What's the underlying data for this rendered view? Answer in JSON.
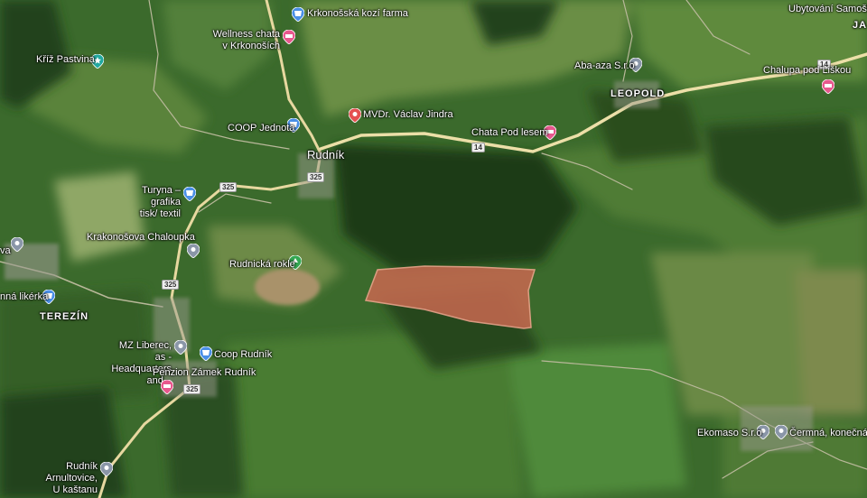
{
  "map": {
    "places": {
      "rudnik": "Rudník",
      "leopold": "LEOPOLD",
      "terezin": "TEREZÍN",
      "ja": "JA"
    },
    "roads": {
      "r325_a": "325",
      "r325_b": "325",
      "r325_c": "325",
      "r325_d": "325",
      "r14_a": "14",
      "r14_b": "14"
    },
    "pois": [
      {
        "id": "krkonosska",
        "label": "Krkonošská kozí farma",
        "icon": "shopping-pin",
        "color": "#4a8fe6"
      },
      {
        "id": "wellness",
        "label": "Wellness chata\nv Krkonoších",
        "icon": "hotel-pin",
        "color": "#e7588d"
      },
      {
        "id": "kriz",
        "label": "Kříž Pastvina",
        "icon": "attraction-pin",
        "color": "#22a9a0"
      },
      {
        "id": "coop_jednota",
        "label": "COOP Jednota",
        "icon": "shopping-pin",
        "color": "#4a8fe6"
      },
      {
        "id": "mvdr",
        "label": "MVDr. Václav Jindra",
        "icon": "place-pin",
        "color": "#e45050"
      },
      {
        "id": "chata_pod_lesem",
        "label": "Chata Pod lesem",
        "icon": "hotel-pin",
        "color": "#e7588d"
      },
      {
        "id": "aba_aza",
        "label": "Aba-aza S.r.o",
        "icon": "place-pin",
        "color": "#8a96a8"
      },
      {
        "id": "chalupa",
        "label": "Chalupa pod Liškou",
        "icon": "hotel-pin",
        "color": "#e7588d"
      },
      {
        "id": "ubytovani",
        "label": "Ubytování Samoška",
        "icon": "",
        "color": ""
      },
      {
        "id": "turyna",
        "label": "Turyna – grafika\ntisk/ textil",
        "icon": "shopping-pin",
        "color": "#4a8fe6"
      },
      {
        "id": "krakonosova",
        "label": "Krakonošova Chaloupka",
        "icon": "place-pin",
        "color": "#8a96a8"
      },
      {
        "id": "rudnicka",
        "label": "Rudnická rokle",
        "icon": "park-pin",
        "color": "#34a853"
      },
      {
        "id": "likerka",
        "label": "nná likérka",
        "icon": "shopping-pin",
        "color": "#4a8fe6"
      },
      {
        "id": "mz_liberec",
        "label": "MZ Liberec, as -\nHeadquarters and...",
        "icon": "place-pin",
        "color": "#8a96a8"
      },
      {
        "id": "coop_rudnik",
        "label": "Coop Rudník",
        "icon": "shopping-pin",
        "color": "#4a8fe6"
      },
      {
        "id": "penzion",
        "label": "Penzion Zámek Rudník",
        "icon": "hotel-pin",
        "color": "#e7588d"
      },
      {
        "id": "arnultovice",
        "label": "Rudník Arnultovice,\nU kaštanu",
        "icon": "place-pin",
        "color": "#8a96a8"
      },
      {
        "id": "ekomaso",
        "label": "Ekomaso S.r.o",
        "icon": "place-pin",
        "color": "#8a96a8"
      },
      {
        "id": "cermna",
        "label": "Čermná, konečná",
        "icon": "place-pin",
        "color": "#8a96a8"
      },
      {
        "id": "va",
        "label": "va",
        "icon": "place-pin",
        "color": "#8a96a8"
      }
    ],
    "highlight_color": "#c4684f"
  }
}
